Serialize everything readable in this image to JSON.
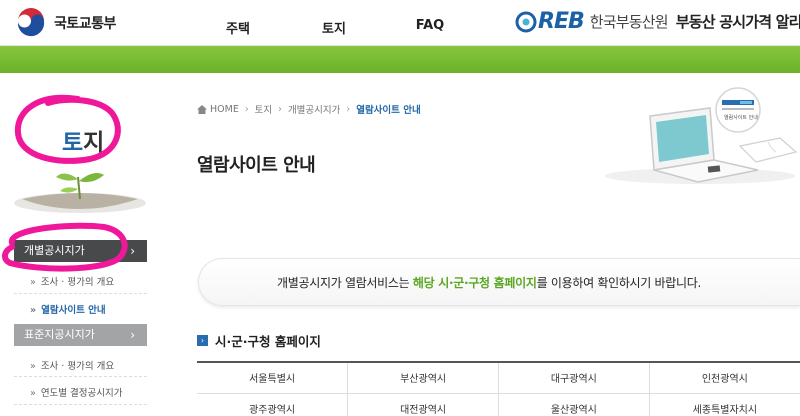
{
  "header": {
    "gov_name": "국토교통부",
    "nav": [
      "주택",
      "토지",
      "FAQ"
    ],
    "reb_word": "REB",
    "reb_org": "한국부동산원",
    "reb_slogan": "부동산 공시가격 알리"
  },
  "sidebar": {
    "title_first": "토",
    "title_rest": "지",
    "menu": [
      {
        "label": "개별공시지가",
        "chevron": "›",
        "subs": [
          {
            "label": "조사 · 평가의 개요"
          },
          {
            "label": "열람사이트 안내"
          }
        ]
      },
      {
        "label": "표준지공시지가",
        "chevron": "›",
        "subs": [
          {
            "label": "조사 · 평가의 개요"
          },
          {
            "label": "연도별 결정공시지가"
          }
        ]
      }
    ]
  },
  "breadcrumb": {
    "home": "HOME",
    "items": [
      "토지",
      "개별공시지가",
      "열람사이트 안내"
    ],
    "sep": "›"
  },
  "page": {
    "title": "열람사이트 안내"
  },
  "illustration": {
    "screen_label": "열람사이트 안내"
  },
  "notice": {
    "pre": "개별공시지가 열람서비스는 ",
    "highlight": "해당 시·군·구청 홈페이지",
    "post": "를 이용하여 확인하시기 바랍니다."
  },
  "section": {
    "title": "시·군·구청 홈페이지"
  },
  "regions": [
    [
      "서울특별시",
      "부산광역시",
      "대구광역시",
      "인천광역시"
    ],
    [
      "광주광역시",
      "대전광역시",
      "울산광역시",
      "세종특별자치시"
    ]
  ],
  "colors": {
    "green_bar": "#78bc34",
    "brand_blue": "#1c61a8",
    "marker_pink": "#f0189a",
    "active_menu": "#47494b"
  }
}
